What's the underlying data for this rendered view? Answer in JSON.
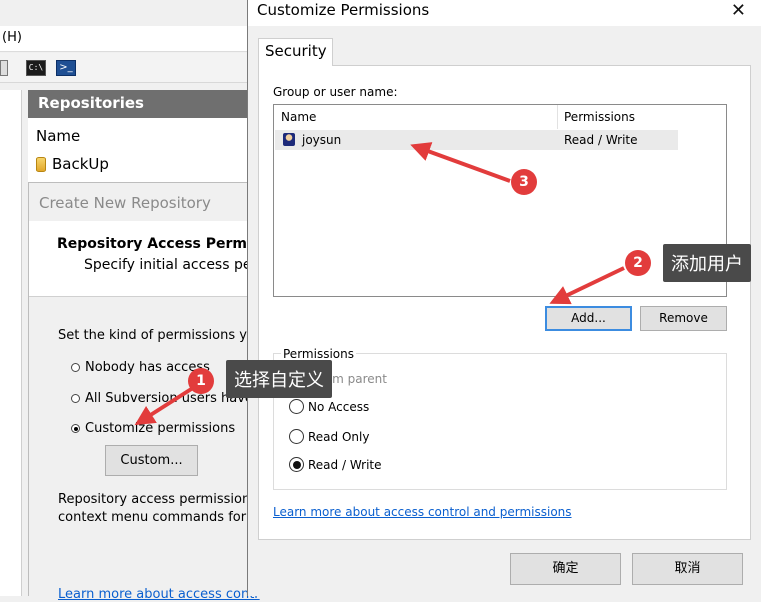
{
  "background": {
    "menu_fragment": "(H)",
    "toolbar": {
      "cmd_glyph": "C:\\",
      "ps_glyph": ">_"
    },
    "repositories_header": "Repositories",
    "list_column_name": "Name",
    "repo_item": "BackUp",
    "create_dialog": {
      "title": "Create New Repository",
      "heading": "Repository Access Permis",
      "subheading": "Specify initial access per",
      "set_kind": "Set the kind of permissions you w",
      "options": [
        "Nobody has access",
        "All Subversion users have R",
        "Customize permissions"
      ],
      "selected_option_index": 2,
      "custom_button": "Custom...",
      "desc_line1": "Repository access permissions c",
      "desc_line2": "context menu commands for the",
      "learn_more": "Learn more about access contr"
    }
  },
  "dialog": {
    "title": "Customize Permissions",
    "close_glyph": "✕",
    "tab_label": "Security",
    "group_label": "Group or user name:",
    "columns": {
      "name": "Name",
      "permissions": "Permissions"
    },
    "users": [
      {
        "name": "joysun",
        "permissions": "Read / Write"
      }
    ],
    "add_button": "Add...",
    "remove_button": "Remove",
    "permissions_legend": "Permissions",
    "inherit_text": "it from parent",
    "options": [
      "No Access",
      "Read Only",
      "Read / Write"
    ],
    "selected_option_index": 2,
    "learn_link": "Learn more about access control and permissions",
    "ok_button": "确定",
    "cancel_button": "取消"
  },
  "annotations": {
    "badge1": "1",
    "badge2": "2",
    "badge3": "3",
    "callout1": "选择自定义",
    "callout2": "添加用户",
    "color": "#e23c3c"
  }
}
